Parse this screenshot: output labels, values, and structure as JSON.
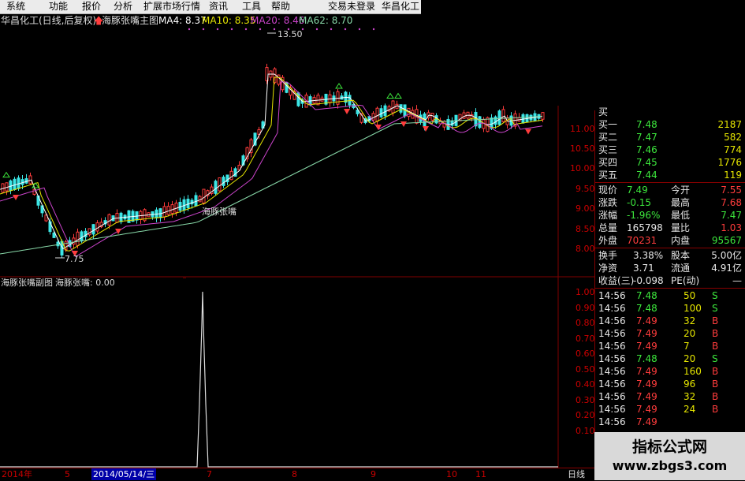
{
  "menu": {
    "items": [
      "系统",
      "功能",
      "报价",
      "分析",
      "扩展市场行情",
      "资讯",
      "工具",
      "帮助"
    ],
    "login": "交易未登录",
    "stock": "华昌化工"
  },
  "header": {
    "title": "华昌化工(日线,后复权)",
    "indicator": "海豚张嘴主图",
    "ma4": "MA4: 8.37",
    "ma10": "MA10: 8.35",
    "ma20": "MA20: 8.46",
    "ma62": "MA62: 8.70"
  },
  "main_chart": {
    "high_label": "13.50",
    "low_label": "7.75",
    "signal_label": "海豚张嘴",
    "price_ticks": [
      "11.00",
      "10.50",
      "10.00",
      "9.50",
      "9.00",
      "8.50",
      "8.00"
    ]
  },
  "sub_chart": {
    "title": "海豚张嘴副图",
    "indicator_value": "海豚张嘴: 0.00",
    "ticks": [
      "1.00",
      "0.90",
      "0.80",
      "0.70",
      "0.60",
      "0.50",
      "0.40",
      "0.30",
      "0.20",
      "0.10"
    ]
  },
  "quote": {
    "top_partial": "买",
    "bids": [
      {
        "label": "买一",
        "price": "7.48",
        "vol": "2187"
      },
      {
        "label": "买二",
        "price": "7.47",
        "vol": "582"
      },
      {
        "label": "买三",
        "price": "7.46",
        "vol": "774"
      },
      {
        "label": "买四",
        "price": "7.45",
        "vol": "1776"
      },
      {
        "label": "买五",
        "price": "7.44",
        "vol": "119"
      }
    ],
    "stats": [
      {
        "l1": "现价",
        "v1": "7.49",
        "l2": "今开",
        "v2": "7.55",
        "c1": "green",
        "c2": "red"
      },
      {
        "l1": "涨跌",
        "v1": "-0.15",
        "l2": "最高",
        "v2": "7.68",
        "c1": "green",
        "c2": "red"
      },
      {
        "l1": "涨幅",
        "v1": "-1.96%",
        "l2": "最低",
        "v2": "7.47",
        "c1": "green",
        "c2": "green"
      },
      {
        "l1": "总量",
        "v1": "165798",
        "l2": "量比",
        "v2": "1.03",
        "c1": "white",
        "c2": "red"
      },
      {
        "l1": "外盘",
        "v1": "70231",
        "l2": "内盘",
        "v2": "95567",
        "c1": "red",
        "c2": "green"
      }
    ],
    "fundamentals": [
      {
        "l1": "换手",
        "v1": "3.38%",
        "l2": "股本",
        "v2": "5.00亿"
      },
      {
        "l1": "净资",
        "v1": "3.71",
        "l2": "流通",
        "v2": "4.91亿"
      },
      {
        "l1": "收益(三)",
        "v1": "-0.098",
        "l2": "PE(动)",
        "v2": "—"
      }
    ],
    "ticks": [
      {
        "time": "14:56",
        "price": "7.48",
        "vol": "50",
        "side": "S"
      },
      {
        "time": "14:56",
        "price": "7.48",
        "vol": "100",
        "side": "S"
      },
      {
        "time": "14:56",
        "price": "7.49",
        "vol": "32",
        "side": "B"
      },
      {
        "time": "14:56",
        "price": "7.49",
        "vol": "20",
        "side": "B"
      },
      {
        "time": "14:56",
        "price": "7.49",
        "vol": "7",
        "side": "B"
      },
      {
        "time": "14:56",
        "price": "7.48",
        "vol": "20",
        "side": "S"
      },
      {
        "time": "14:56",
        "price": "7.49",
        "vol": "160",
        "side": "B"
      },
      {
        "time": "14:56",
        "price": "7.49",
        "vol": "96",
        "side": "B"
      },
      {
        "time": "14:56",
        "price": "7.49",
        "vol": "32",
        "side": "B"
      },
      {
        "time": "14:56",
        "price": "7.49",
        "vol": "24",
        "side": "B"
      },
      {
        "time": "14:56",
        "price": "7.49",
        "vol": "",
        "side": ""
      }
    ]
  },
  "bottom": {
    "year": "2014年",
    "m5": "5",
    "date": "2014/05/14/三",
    "m7": "7",
    "m8": "8",
    "m9": "9",
    "m10": "10",
    "m11": "11",
    "period": "日线"
  },
  "watermark": {
    "title": "指标公式网",
    "url": "www.zbgs3.com"
  },
  "colors": {
    "up": "#ff3c3c",
    "down": "#3ce6e6",
    "ma_white": "#ffffff",
    "ma_yellow": "#e6e600",
    "ma_purple": "#cc44cc",
    "ma_green": "#88d8a8",
    "grid": "#800000"
  }
}
